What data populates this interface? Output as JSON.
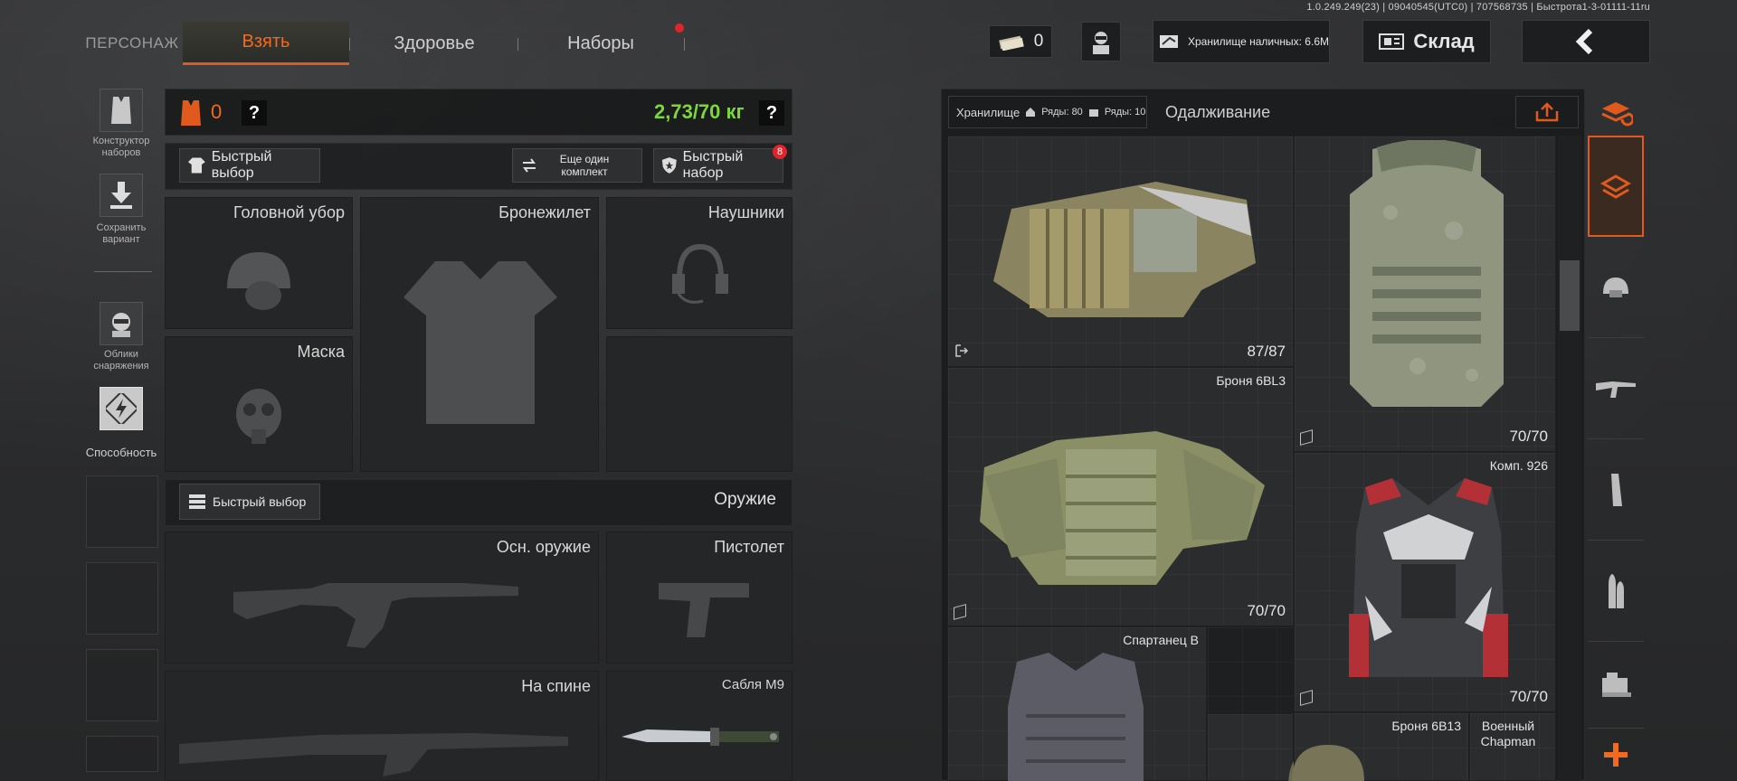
{
  "version_info": "1.0.249.249(23) | 09040545(UTC0) | 707568735 | Быстрота1-3-01111-11ru",
  "top_tabs": {
    "character": "ПЕРСОНАЖ",
    "take": "Взять",
    "health": "Здоровье",
    "sets": "Наборы"
  },
  "top_right": {
    "cash_count": "0",
    "cash_storage": "Хранилище наличных: 6.6M",
    "warehouse": "Склад"
  },
  "left_rail": {
    "kit_builder": "Конструктор наборов",
    "save_variant": "Сохранить вариант",
    "gear_looks": "Облики снаряжения",
    "ability": "Способность"
  },
  "loadout": {
    "armor_count": "0",
    "weight": "2,73/70 кг",
    "quick_pick": "Быстрый выбор",
    "another_kit": "Еще один комплект",
    "quick_set": "Быстрый набор",
    "quick_set_badge": "8",
    "slots": {
      "headgear": "Головной убор",
      "vest": "Бронежилет",
      "headphones": "Наушники",
      "mask": "Маска"
    },
    "weapons_quick_pick": "Быстрый выбор",
    "weapons_title": "Оружие",
    "primary": "Осн. оружие",
    "pistol": "Пистолет",
    "back": "На спине",
    "melee": "Сабля M9"
  },
  "storage": {
    "label": "Хранилище",
    "rows1": "Ряды: 80",
    "rows2": "Ряды: 10",
    "borrowing": "Одалживание",
    "items": [
      {
        "name": "",
        "durability": "87/87"
      },
      {
        "name": "",
        "durability": "70/70"
      },
      {
        "name": "Броня 6BL3",
        "durability": "70/70"
      },
      {
        "name": "Комп. 926",
        "durability": "70/70"
      },
      {
        "name": "Спартанец B",
        "durability": ""
      },
      {
        "name": "Броня 6B13",
        "durability": ""
      },
      {
        "name": "Военный Chapman",
        "durability": ""
      }
    ]
  },
  "categories": [
    "layers-refresh-icon",
    "stack-icon",
    "helmet-icon",
    "rifle-icon",
    "magazine-icon",
    "ammo-icon",
    "attachment-icon",
    "plus-icon"
  ],
  "colors": {
    "accent": "#e05a1e",
    "weight_green": "#7dd63a",
    "badge_red": "#e0242a"
  }
}
